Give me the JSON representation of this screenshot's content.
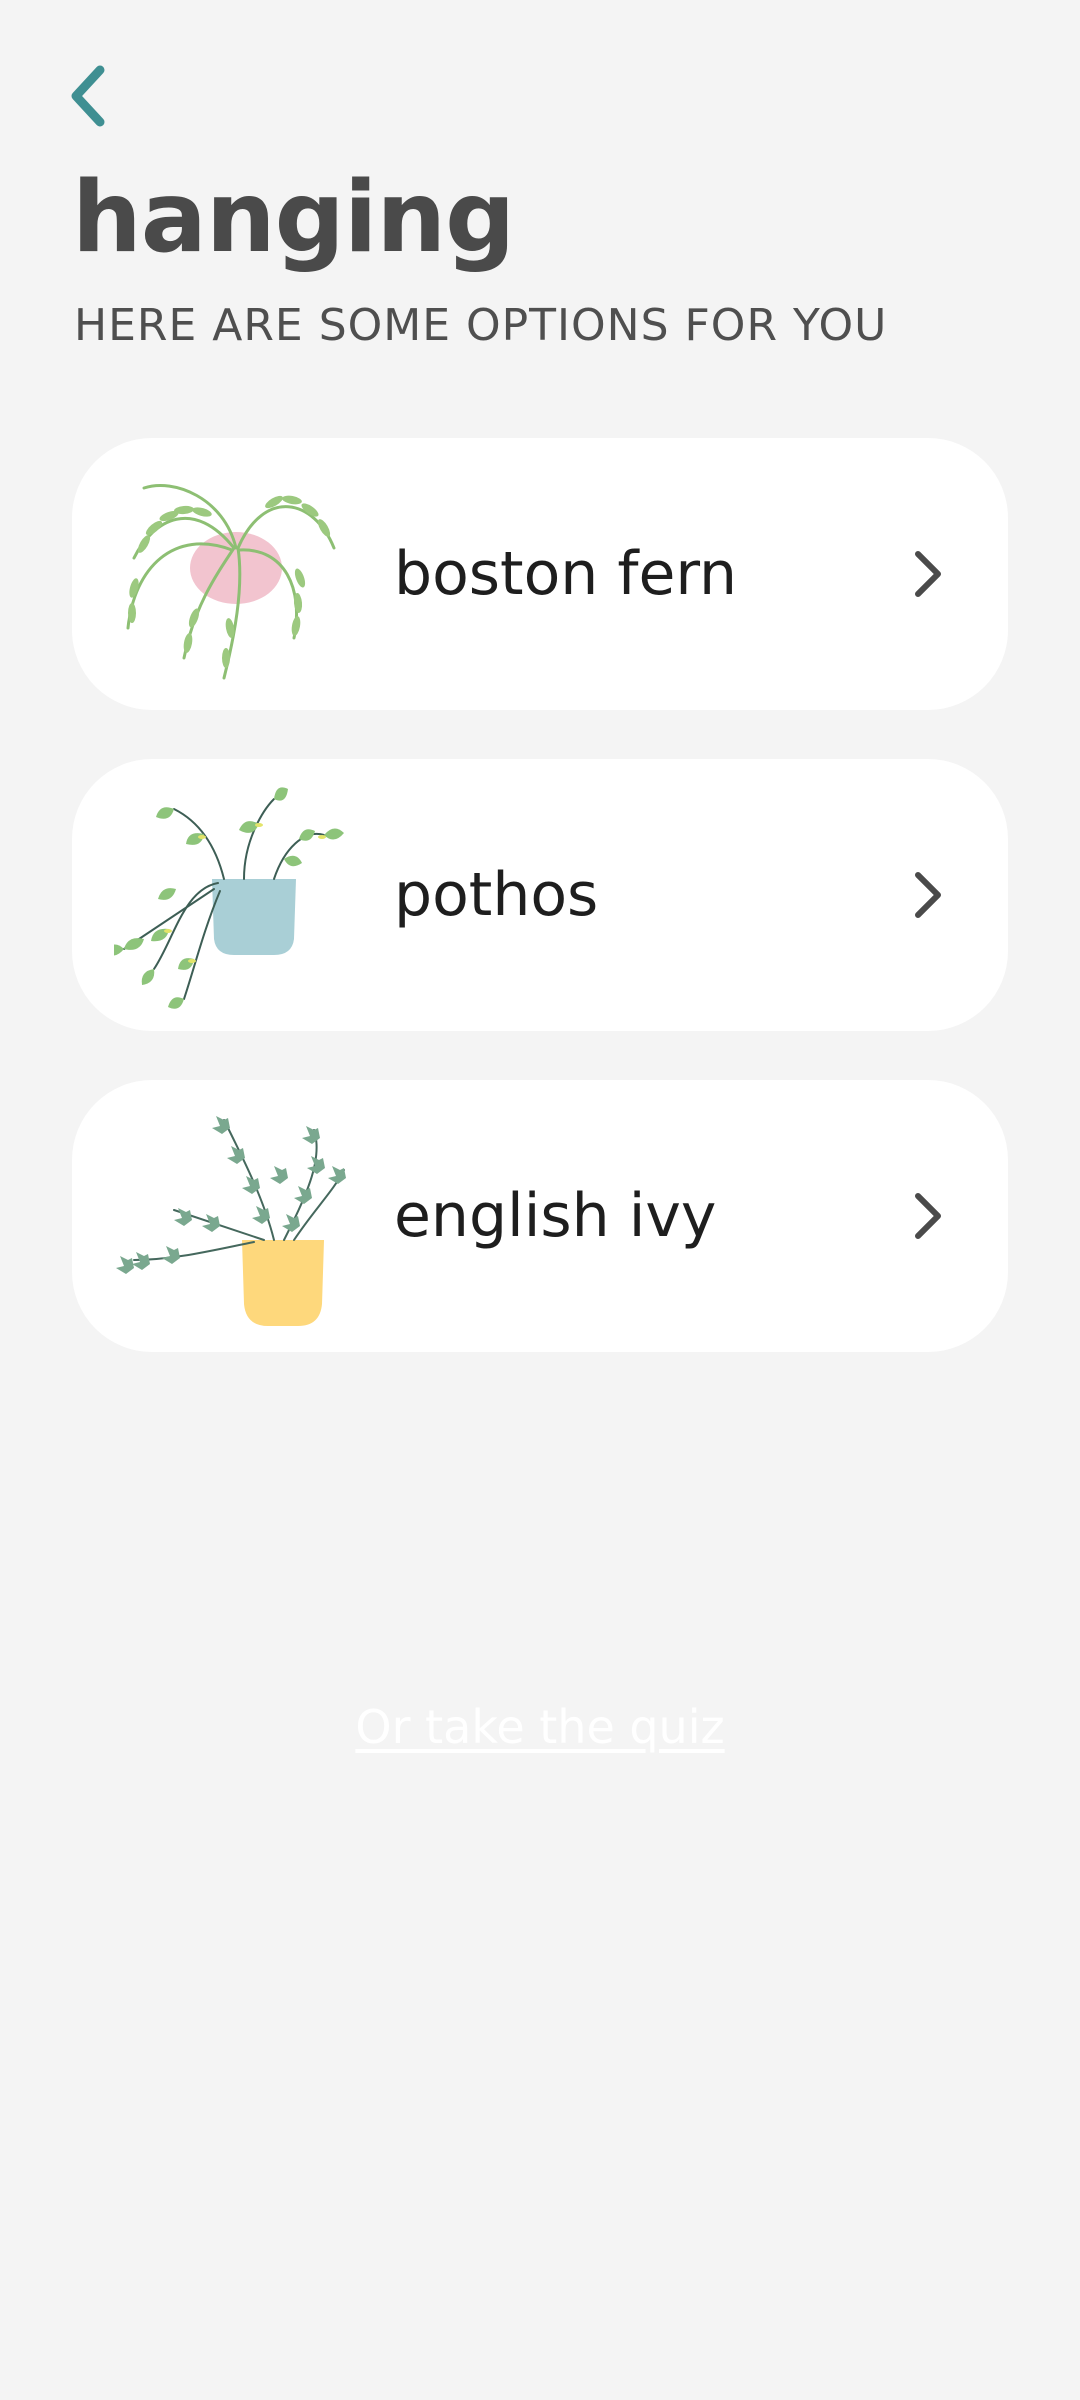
{
  "header": {
    "back_icon": "chevron-left-icon",
    "title": "hanging",
    "subtitle": "HERE ARE SOME OPTIONS FOR YOU"
  },
  "options": [
    {
      "label": "boston fern",
      "icon": "boston-fern-plant-icon",
      "pot_color": "#f2c4cf"
    },
    {
      "label": "pothos",
      "icon": "pothos-plant-icon",
      "pot_color": "#a9cfd6"
    },
    {
      "label": "english ivy",
      "icon": "english-ivy-plant-icon",
      "pot_color": "#fed87c"
    }
  ],
  "quiz_link": "Or take the quiz",
  "colors": {
    "accent": "#3f8f92",
    "background": "#f4f4f4",
    "card": "#ffffff",
    "text": "#4a4a4a"
  }
}
